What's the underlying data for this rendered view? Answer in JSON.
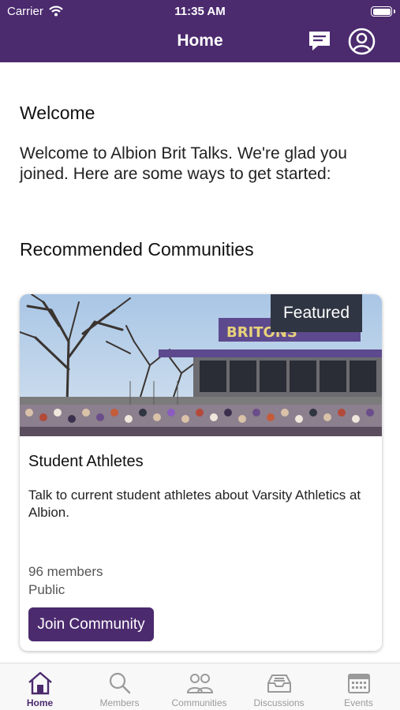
{
  "status_bar": {
    "carrier": "Carrier",
    "time": "11:35 AM"
  },
  "header": {
    "title": "Home",
    "messages_icon": "chat-bubble-icon",
    "profile_icon": "user-circle-icon"
  },
  "welcome": {
    "heading": "Welcome",
    "text": "Welcome to Albion Brit Talks. We're glad you joined. Here are some ways to get started:"
  },
  "recommended": {
    "heading": "Recommended Communities",
    "card": {
      "badge": "Featured",
      "title": "Student Athletes",
      "description": "Talk to current student athletes about Varsity Athletics at Albion.",
      "members": "96 members",
      "visibility": "Public",
      "join_label": "Join Community",
      "sign_text": "BRITONS"
    }
  },
  "tabbar": {
    "tabs": [
      {
        "label": "Home",
        "icon": "home-icon",
        "active": true
      },
      {
        "label": "Members",
        "icon": "search-icon",
        "active": false
      },
      {
        "label": "Communities",
        "icon": "people-icon",
        "active": false
      },
      {
        "label": "Discussions",
        "icon": "inbox-icon",
        "active": false
      },
      {
        "label": "Events",
        "icon": "calendar-icon",
        "active": false
      }
    ]
  },
  "colors": {
    "brand": "#4b2a6e",
    "badge_bg": "#2f3542",
    "inactive": "#9a9a9a"
  }
}
